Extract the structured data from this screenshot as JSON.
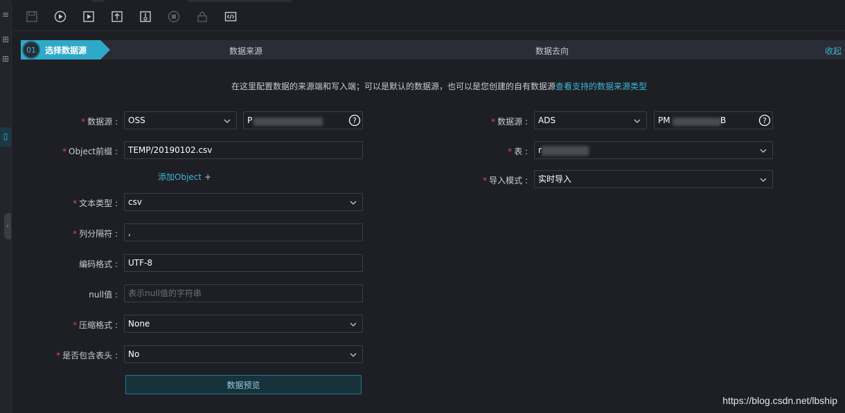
{
  "toolbar": {
    "icons": [
      "save-icon",
      "run-icon",
      "run-params-icon",
      "submit-icon",
      "deploy-icon",
      "stop-icon",
      "lock-icon",
      "code-icon"
    ]
  },
  "steps": {
    "active_num": "01",
    "active_label": "选择数据源",
    "step2": "数据来源",
    "step3": "数据去向",
    "collapse": "收起"
  },
  "info": {
    "text": "在这里配置数据的来源端和写入端；可以是默认的数据源，也可以是您创建的自有数据源",
    "link": "查看支持的数据来源类型"
  },
  "source": {
    "datasource_label": "数据源 :",
    "datasource_type": "OSS",
    "datasource_name": "P",
    "object_prefix_label": "Object前缀 :",
    "object_prefix": "TEMP/20190102.csv",
    "add_object": "添加Object",
    "add_plus": "+",
    "file_type_label": "文本类型 :",
    "file_type": "csv",
    "delimiter_label": "列分隔符 :",
    "delimiter": ",",
    "encoding_label": "编码格式 :",
    "encoding": "UTF-8",
    "null_label": "null值 :",
    "null_placeholder": "表示null值的字符串",
    "compress_label": "压缩格式 :",
    "compress": "None",
    "header_label": "是否包含表头 :",
    "header": "No",
    "preview_button": "数据预览"
  },
  "target": {
    "datasource_label": "数据源 :",
    "datasource_type": "ADS",
    "datasource_name_start": "PM",
    "datasource_name_end": "B",
    "table_label": "表 :",
    "table": "r",
    "import_mode_label": "导入模式 :",
    "import_mode": "实时导入"
  },
  "watermark": "https://blog.csdn.net/lbship",
  "colors": {
    "background": "#1d1f24",
    "accent": "#2fa9c9",
    "link": "#3ab7d6",
    "required": "#e04a4a"
  }
}
